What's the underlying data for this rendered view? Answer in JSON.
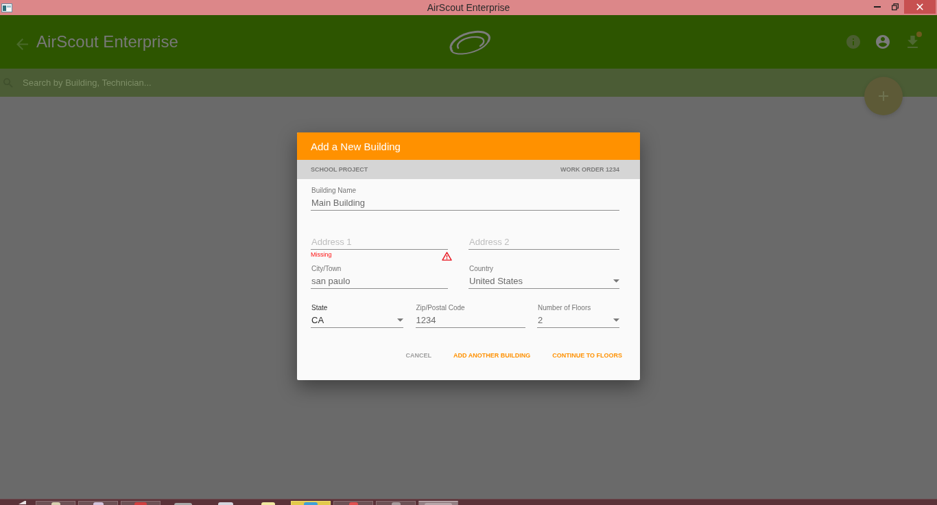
{
  "window": {
    "title": "AirScout Enterprise"
  },
  "app_bar": {
    "title": "AirScout Enterprise"
  },
  "search": {
    "placeholder": "Search by Building, Technician..."
  },
  "dialog": {
    "title": "Add a New Building",
    "project": "SCHOOL PROJECT",
    "work_order": "WORK ORDER 1234",
    "rows": [
      [
        {
          "kind": "text",
          "label": "Building Name",
          "value": "Main Building",
          "highlighted": false
        }
      ],
      [
        {
          "kind": "text",
          "placeholder": "Address 1",
          "error": "Missing",
          "highlighted": false
        },
        {
          "kind": "text",
          "placeholder": "Address 2",
          "highlighted": false
        }
      ],
      [
        {
          "kind": "text",
          "label": "City/Town",
          "value": "san paulo",
          "highlighted": false
        },
        {
          "kind": "select",
          "label": "Country",
          "value": "United States",
          "highlighted": false
        }
      ],
      [
        {
          "kind": "select",
          "label": "State",
          "value": "CA",
          "highlighted": true
        },
        {
          "kind": "text",
          "label": "Zip/Postal Code",
          "value": "1234",
          "highlighted": false
        },
        {
          "kind": "select",
          "label": "Number of Floors",
          "value": "2",
          "highlighted": false
        }
      ]
    ],
    "buttons": [
      {
        "label": "CANCEL",
        "kind": "plain"
      },
      {
        "label": "ADD ANOTHER BUILDING",
        "kind": "accent"
      },
      {
        "label": "CONTINUE TO FLOORS",
        "kind": "accent"
      }
    ]
  },
  "taskbar": {
    "items": [
      {
        "running": true,
        "selected": false,
        "flashing": false
      },
      {
        "running": true,
        "selected": false,
        "flashing": false
      },
      {
        "running": true,
        "selected": false,
        "flashing": false
      },
      {
        "running": false,
        "selected": false,
        "flashing": false
      },
      {
        "running": false,
        "selected": false,
        "flashing": false
      },
      {
        "running": false,
        "selected": false,
        "flashing": false
      },
      {
        "running": true,
        "selected": false,
        "flashing": true
      },
      {
        "running": true,
        "selected": false,
        "flashing": false
      },
      {
        "running": true,
        "selected": false,
        "flashing": false
      },
      {
        "running": true,
        "selected": true,
        "flashing": false
      }
    ]
  }
}
